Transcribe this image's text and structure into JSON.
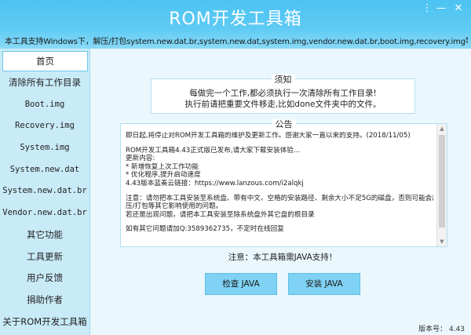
{
  "window": {
    "title": "ROM开发工具箱",
    "subtitle": "本工具支持Windows下，解压/打包system.new.dat.br,system.new.dat,system.img,vendor.new.dat.br,boot.img,recovery.img等多项功能！",
    "controls": {
      "menu": "⋮",
      "minimize": "—",
      "close": "✕"
    }
  },
  "sidebar": {
    "items": [
      {
        "label": "首页"
      },
      {
        "label": "清除所有工作目录"
      },
      {
        "label": "Boot.img"
      },
      {
        "label": "Recovery.img"
      },
      {
        "label": "System.img"
      },
      {
        "label": "System.new.dat"
      },
      {
        "label": "System.new.dat.br"
      },
      {
        "label": "Vendor.new.dat.br"
      },
      {
        "label": "其它功能"
      },
      {
        "label": "工具更新"
      },
      {
        "label": "用户反馈"
      },
      {
        "label": "捐助作者"
      },
      {
        "label": "关于ROM开发工具箱"
      }
    ]
  },
  "notice": {
    "title": "须知",
    "lines": [
      "每做完一个工作,都必须执行一次清除所有工作目录!",
      "执行前请把重要文件移走,比如done文件夹中的文件。"
    ]
  },
  "announcement": {
    "title": "公告",
    "lines": [
      "即日起,将停止对ROM开发工具箱的维护及更新工作。感谢大家一直以来的支持。(2018/11/05)",
      "",
      "ROM开发工具箱4.43正式版已发布,请大家下载安装体验...",
      "更新内容:",
      "* 新增恢复上次工作功能",
      "* 优化程序,提升启动速度",
      "4.43版本蓝奏云链接：https://www.lanzous.com/i2alqkj",
      "",
      "注意：请勿把本工具安装至系统盘、带有中文、空格的安装路径、剩余大小不足5G的磁盘，否则可能会出现解",
      "压/打包等其它影响使用的问题。",
      "若还是出现问题，请把本工具安装至除系统盘外其它盘的根目录",
      "",
      "如有其它问题请加Q:3589362735，不定时在线回复"
    ]
  },
  "java": {
    "note": "注意：本工具箱需JAVA支持！",
    "check_button": "检查 JAVA",
    "install_button": "安装 JAVA"
  },
  "footer": {
    "version": "版本号： 4.43"
  }
}
